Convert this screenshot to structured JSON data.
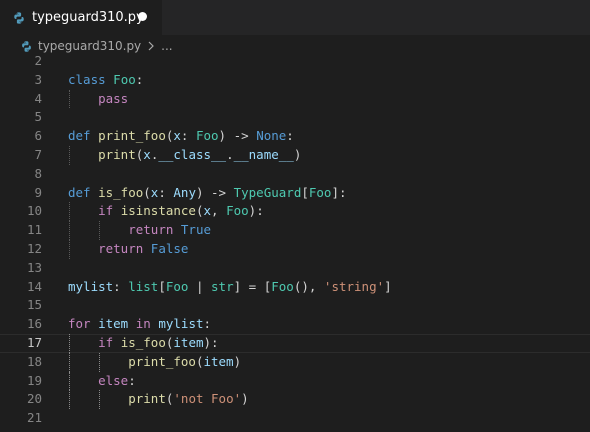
{
  "tab": {
    "filename": "typeguard310.py",
    "dirty": true
  },
  "breadcrumb": {
    "file": "typeguard310.py",
    "trail": "..."
  },
  "editor": {
    "current_line": 17,
    "lines": [
      {
        "n": "2",
        "tokens": []
      },
      {
        "n": "3",
        "tokens": [
          {
            "t": "class",
            "c": "kw"
          },
          {
            "t": " "
          },
          {
            "t": "Foo",
            "c": "cls"
          },
          {
            "t": ":"
          }
        ]
      },
      {
        "n": "4",
        "tokens": [
          {
            "t": "    "
          },
          {
            "t": "pass",
            "c": "ctl"
          }
        ]
      },
      {
        "n": "5",
        "tokens": []
      },
      {
        "n": "6",
        "tokens": [
          {
            "t": "def",
            "c": "kw"
          },
          {
            "t": " "
          },
          {
            "t": "print_foo",
            "c": "fn"
          },
          {
            "t": "("
          },
          {
            "t": "x",
            "c": "var"
          },
          {
            "t": ": "
          },
          {
            "t": "Foo",
            "c": "cls"
          },
          {
            "t": ") -> "
          },
          {
            "t": "None",
            "c": "kw"
          },
          {
            "t": ":"
          }
        ]
      },
      {
        "n": "7",
        "tokens": [
          {
            "t": "    "
          },
          {
            "t": "print",
            "c": "fn"
          },
          {
            "t": "("
          },
          {
            "t": "x",
            "c": "var"
          },
          {
            "t": "."
          },
          {
            "t": "__class__",
            "c": "var"
          },
          {
            "t": "."
          },
          {
            "t": "__name__",
            "c": "var"
          },
          {
            "t": ")"
          }
        ]
      },
      {
        "n": "8",
        "tokens": []
      },
      {
        "n": "9",
        "tokens": [
          {
            "t": "def",
            "c": "kw"
          },
          {
            "t": " "
          },
          {
            "t": "is_foo",
            "c": "fn"
          },
          {
            "t": "("
          },
          {
            "t": "x",
            "c": "var"
          },
          {
            "t": ": "
          },
          {
            "t": "Any",
            "c": "var"
          },
          {
            "t": ") -> "
          },
          {
            "t": "TypeGuard",
            "c": "cls"
          },
          {
            "t": "["
          },
          {
            "t": "Foo",
            "c": "cls"
          },
          {
            "t": "]:"
          }
        ]
      },
      {
        "n": "10",
        "tokens": [
          {
            "t": "    "
          },
          {
            "t": "if",
            "c": "ctl"
          },
          {
            "t": " "
          },
          {
            "t": "isinstance",
            "c": "fn"
          },
          {
            "t": "("
          },
          {
            "t": "x",
            "c": "var"
          },
          {
            "t": ", "
          },
          {
            "t": "Foo",
            "c": "cls"
          },
          {
            "t": "):"
          }
        ]
      },
      {
        "n": "11",
        "tokens": [
          {
            "t": "        "
          },
          {
            "t": "return",
            "c": "ctl"
          },
          {
            "t": " "
          },
          {
            "t": "True",
            "c": "kw"
          }
        ]
      },
      {
        "n": "12",
        "tokens": [
          {
            "t": "    "
          },
          {
            "t": "return",
            "c": "ctl"
          },
          {
            "t": " "
          },
          {
            "t": "False",
            "c": "kw"
          }
        ]
      },
      {
        "n": "13",
        "tokens": []
      },
      {
        "n": "14",
        "tokens": [
          {
            "t": "mylist",
            "c": "var"
          },
          {
            "t": ": "
          },
          {
            "t": "list",
            "c": "cls"
          },
          {
            "t": "["
          },
          {
            "t": "Foo",
            "c": "cls"
          },
          {
            "t": " | "
          },
          {
            "t": "str",
            "c": "cls"
          },
          {
            "t": "] = ["
          },
          {
            "t": "Foo",
            "c": "cls"
          },
          {
            "t": "(), "
          },
          {
            "t": "'string'",
            "c": "str"
          },
          {
            "t": "]"
          }
        ]
      },
      {
        "n": "15",
        "tokens": []
      },
      {
        "n": "16",
        "tokens": [
          {
            "t": "for",
            "c": "ctl"
          },
          {
            "t": " "
          },
          {
            "t": "item",
            "c": "var"
          },
          {
            "t": " "
          },
          {
            "t": "in",
            "c": "ctl"
          },
          {
            "t": " "
          },
          {
            "t": "mylist",
            "c": "var"
          },
          {
            "t": ":"
          }
        ]
      },
      {
        "n": "17",
        "tokens": [
          {
            "t": "    "
          },
          {
            "t": "if",
            "c": "ctl"
          },
          {
            "t": " "
          },
          {
            "t": "is_foo",
            "c": "fn"
          },
          {
            "t": "("
          },
          {
            "t": "item",
            "c": "var"
          },
          {
            "t": "):"
          }
        ]
      },
      {
        "n": "18",
        "tokens": [
          {
            "t": "        "
          },
          {
            "t": "print_foo",
            "c": "fn"
          },
          {
            "t": "("
          },
          {
            "t": "item",
            "c": "var"
          },
          {
            "t": ")"
          }
        ]
      },
      {
        "n": "19",
        "tokens": [
          {
            "t": "    "
          },
          {
            "t": "else",
            "c": "ctl"
          },
          {
            "t": ":"
          }
        ]
      },
      {
        "n": "20",
        "tokens": [
          {
            "t": "        "
          },
          {
            "t": "print",
            "c": "fn"
          },
          {
            "t": "("
          },
          {
            "t": "'not Foo'",
            "c": "str"
          },
          {
            "t": ")"
          }
        ]
      },
      {
        "n": "21",
        "tokens": []
      }
    ]
  },
  "colors": {
    "background": "#1e1e1e",
    "tabbar": "#252526",
    "keyword": "#569cd6",
    "control": "#c586c0",
    "function": "#dcdcaa",
    "class": "#4ec9b0",
    "variable": "#9cdcfe",
    "string": "#ce9178"
  },
  "icons": {
    "file": "python-file-icon",
    "dirty": "unsaved-dot-icon",
    "separator": "chevron-right-icon"
  }
}
